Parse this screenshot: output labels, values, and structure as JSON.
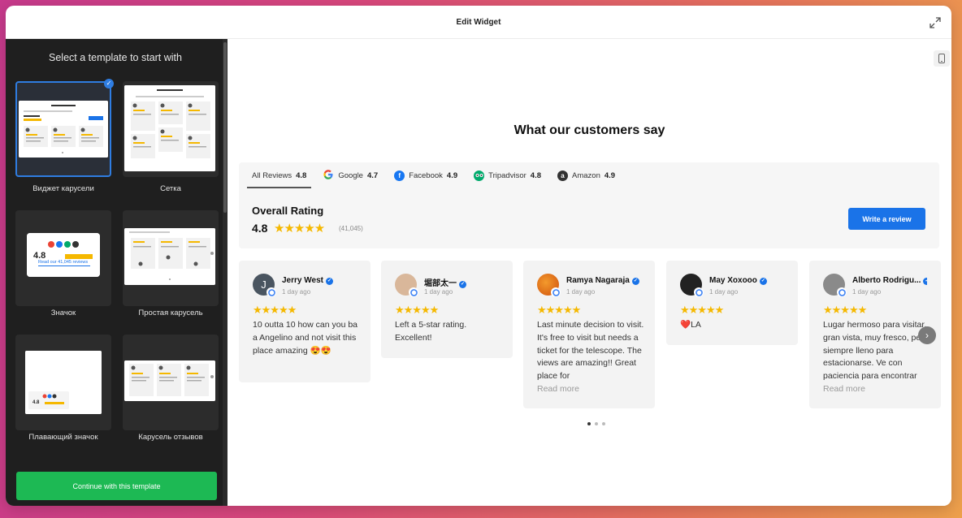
{
  "window": {
    "title": "Edit Widget"
  },
  "sidebar": {
    "heading": "Select a template to start with",
    "templates": [
      {
        "label": "Виджет карусели",
        "selected": true
      },
      {
        "label": "Сетка"
      },
      {
        "label": "Значок"
      },
      {
        "label": "Простая карусель"
      },
      {
        "label": "Плавающий значок"
      },
      {
        "label": "Карусель отзывов"
      }
    ],
    "thumb_texts": {
      "badge_rating": "4.8",
      "badge_link": "Read our 41,045 reviews",
      "floating_rating": "4.8"
    },
    "continue_label": "Continue with this template"
  },
  "preview": {
    "title": "What our customers say",
    "tabs": [
      {
        "label": "All Reviews",
        "score": "4.8",
        "icon": "none"
      },
      {
        "label": "Google",
        "score": "4.7",
        "icon": "google-icon"
      },
      {
        "label": "Facebook",
        "score": "4.9",
        "icon": "facebook-icon"
      },
      {
        "label": "Tripadvisor",
        "score": "4.8",
        "icon": "tripadvisor-icon"
      },
      {
        "label": "Amazon",
        "score": "4.9",
        "icon": "amazon-icon"
      }
    ],
    "overall": {
      "label": "Overall Rating",
      "value": "4.8",
      "stars": "★★★★★",
      "count": "(41,045)"
    },
    "write_review_label": "Write a review",
    "reviews": [
      {
        "name": "Jerry West",
        "time": "1 day ago",
        "stars": "★★★★★",
        "text": "10 outta 10 how can you ba a Angelino and not visit this place amazing 😍😍",
        "read_more": ""
      },
      {
        "name": "堀部太一",
        "time": "1 day ago",
        "stars": "★★★★★",
        "text": "Left a 5-star rating. Excellent!",
        "read_more": ""
      },
      {
        "name": "Ramya Nagaraja",
        "time": "1 day ago",
        "stars": "★★★★★",
        "text": "Last minute decision to visit. It's free to visit but needs a ticket for the telescope. The views are amazing!! Great place for",
        "read_more": "Read more"
      },
      {
        "name": "May Xoxooo",
        "time": "1 day ago",
        "stars": "★★★★★",
        "text": "❤️LA",
        "read_more": ""
      },
      {
        "name": "Alberto Rodrigu...",
        "time": "1 day ago",
        "stars": "★★★★★",
        "text": "Lugar hermoso para visitar, gran vista, muy fresco, pero siempre lleno para estacionarse. Ve con paciencia para encontrar",
        "read_more": "Read more"
      }
    ],
    "pagination": {
      "pages": 3,
      "current": 1
    }
  },
  "colors": {
    "accent": "#1a73e8",
    "continue": "#1db954",
    "star": "#f5b800",
    "sidebar_bg": "#1f1f1f"
  }
}
